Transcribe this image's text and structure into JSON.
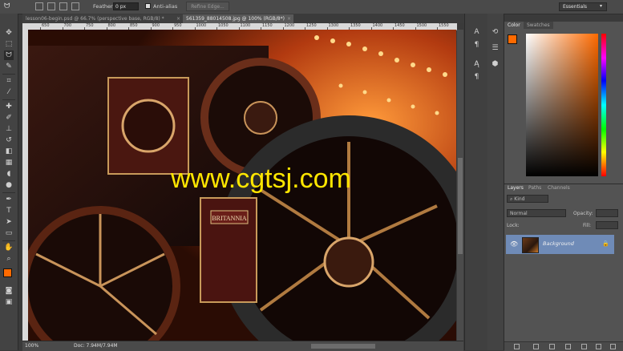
{
  "options_bar": {
    "feather_label": "Feather:",
    "feather_value": "0 px",
    "antialias_label": "Anti-alias",
    "refine_edge_label": "Refine Edge...",
    "workspace_value": "Essentials"
  },
  "tabs": [
    {
      "label": "lesson06-begin.psd @ 66.7% (perspective base, RGB/8) *",
      "active": false
    },
    {
      "label": "561359_88014508.jpg @ 100% (RGB/8*)",
      "active": true
    }
  ],
  "ruler": {
    "labels": [
      "650",
      "700",
      "750",
      "800",
      "850",
      "900",
      "950",
      "1000",
      "1050",
      "1100",
      "1150",
      "1200",
      "1250",
      "1300",
      "1350",
      "1400",
      "1450",
      "1500",
      "1550"
    ]
  },
  "status": {
    "zoom": "100%",
    "doc_info": "Doc: 7.94M/7.94M"
  },
  "watermark": "www.cgtsj.com",
  "plate_text": "BRITANNIA",
  "color_panel": {
    "tabs": [
      "Color",
      "Swatches"
    ],
    "foreground": "#ff6a00",
    "background": "#ffffff"
  },
  "layers_panel": {
    "tabs": [
      "Layers",
      "Paths",
      "Channels"
    ],
    "filter_label": "Kind",
    "blend_mode": "Normal",
    "opacity_label": "Opacity:",
    "lock_label": "Lock:",
    "fill_label": "Fill:",
    "layers": [
      {
        "name": "Background",
        "visible": true,
        "locked": true
      }
    ]
  },
  "colors": {
    "accent": "#ff6a00",
    "selection": "#6f8bb7"
  }
}
